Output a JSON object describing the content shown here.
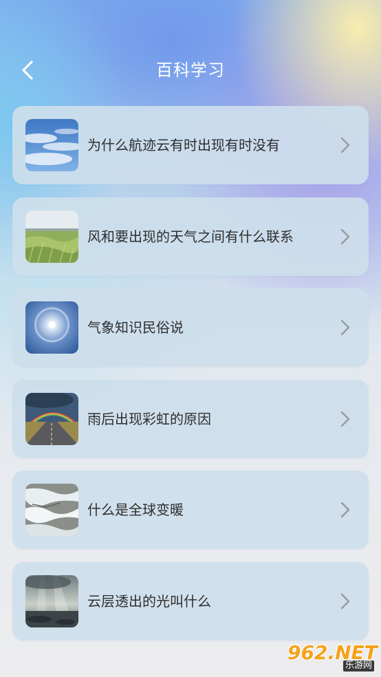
{
  "header": {
    "title": "百科学习",
    "back_icon": "chevron-left-icon"
  },
  "articles": [
    {
      "label": "为什么航迹云有时出现有时没有",
      "thumbnail": "blue-sky-clouds-image"
    },
    {
      "label": "风和要出现的天气之间有什么联系",
      "thumbnail": "wheat-field-image"
    },
    {
      "label": "气象知识民俗说",
      "thumbnail": "sun-halo-image"
    },
    {
      "label": "雨后出现彩虹的原因",
      "thumbnail": "rainbow-road-image"
    },
    {
      "label": "什么是全球变暖",
      "thumbnail": "melting-ice-image"
    },
    {
      "label": "云层透出的光叫什么",
      "thumbnail": "sun-rays-clouds-image"
    }
  ],
  "watermark": {
    "main": "962.NET",
    "sub": "乐游网"
  },
  "colors": {
    "card_background": "#cddeec",
    "label_text": "#2e2e2e",
    "chevron": "#9a9a9a",
    "title_text": "#ffffff"
  }
}
